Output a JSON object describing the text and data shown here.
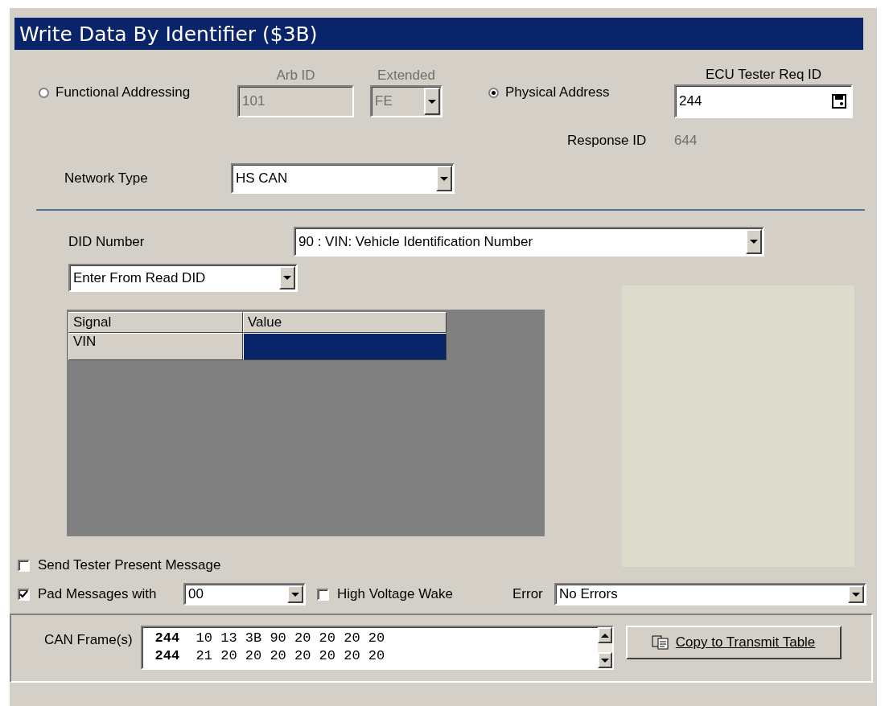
{
  "title": "Write Data By Identifier ($3B)",
  "addressing": [
    {
      "label": "Functional Addressing",
      "selected": false
    },
    {
      "label": "Physical Address",
      "selected": true
    }
  ],
  "arb_id": {
    "label": "Arb ID",
    "value": "101",
    "disabled": true
  },
  "extended": {
    "label": "Extended",
    "value": "FE",
    "disabled": true
  },
  "ecu_tester_req_id": {
    "label": "ECU Tester Req ID",
    "value": "244"
  },
  "response_id": {
    "label": "Response ID",
    "value": "644"
  },
  "network_type": {
    "label": "Network Type",
    "value": "HS CAN"
  },
  "did_number": {
    "label": "DID Number",
    "value": "90 : VIN: Vehicle Identification Number"
  },
  "entry_mode": {
    "value": "Enter From Read DID"
  },
  "table": {
    "columns": [
      "Signal",
      "Value"
    ],
    "rows": [
      {
        "signal": "VIN",
        "value_selected": true
      }
    ]
  },
  "tester_present": {
    "label": "Send Tester Present Message",
    "checked": false
  },
  "pad_messages": {
    "label": "Pad Messages with",
    "checked": true,
    "value": "00"
  },
  "high_voltage_wake": {
    "label": "High Voltage Wake",
    "checked": false
  },
  "error": {
    "label": "Error",
    "value": "No Errors"
  },
  "can_frames": {
    "label": "CAN Frame(s)",
    "lines": [
      {
        "id": "244",
        "bytes": "10 13 3B 90 20 20 20 20"
      },
      {
        "id": "244",
        "bytes": "21 20 20 20 20 20 20 20"
      }
    ]
  },
  "copy_button": {
    "label": "Copy to Transmit Table"
  }
}
